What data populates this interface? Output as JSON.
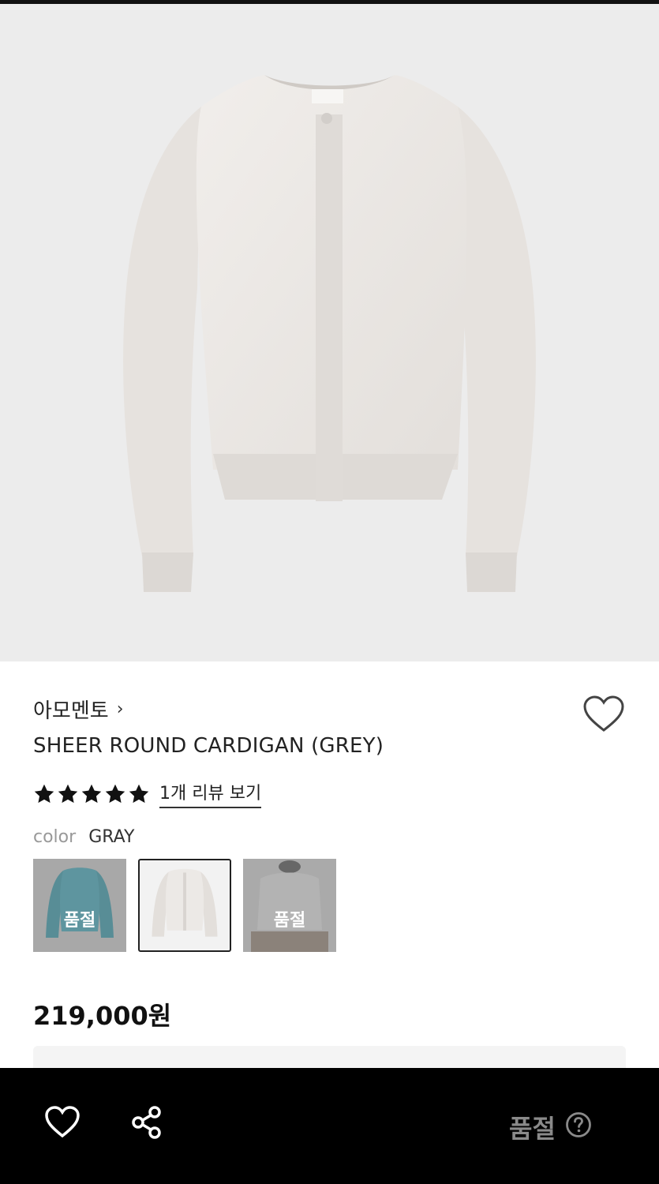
{
  "product": {
    "brand": "아모멘토",
    "brand_chevron": "›",
    "title": "SHEER ROUND CARDIGAN (GREY)",
    "rating_stars": 5,
    "review_link": "1개 리뷰 보기",
    "color_label": "color",
    "color_value": "GRAY",
    "price": "219,000원"
  },
  "swatches": [
    {
      "color": "teal",
      "overlay": "품절",
      "soldout": true
    },
    {
      "color": "gray",
      "overlay": "",
      "selected": true
    },
    {
      "color": "light-gray",
      "overlay": "품절",
      "soldout": true
    }
  ],
  "bottom_bar": {
    "status": "품절"
  },
  "colors": {
    "hero_bg": "#ececec",
    "bottom_bar_bg": "#000000",
    "soldout_text": "#8a8a8a"
  }
}
